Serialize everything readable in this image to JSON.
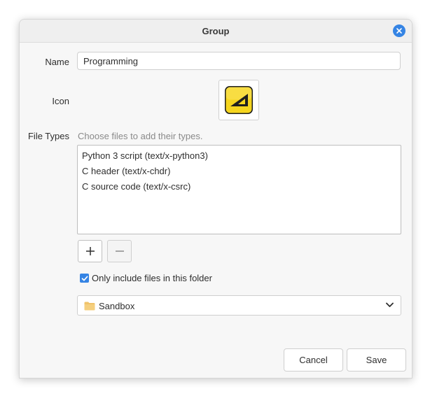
{
  "dialog": {
    "title": "Group"
  },
  "form": {
    "name_label": "Name",
    "name_value": "Programming",
    "icon_label": "Icon",
    "icon_name": "accessories-text-editor-icon",
    "file_types_label": "File Types",
    "file_types_hint": "Choose files to add their types.",
    "file_types": [
      "Python 3 script (text/x-python3)",
      "C header (text/x-chdr)",
      "C source code (text/x-csrc)"
    ],
    "add_icon": "plus-icon",
    "remove_icon": "minus-icon",
    "only_folder_label": "Only include files in this folder",
    "only_folder_checked": true,
    "folder": "Sandbox"
  },
  "actions": {
    "cancel_label": "Cancel",
    "save_label": "Save"
  },
  "colors": {
    "accent": "#3584e4",
    "icon_yellow": "#f5d51e",
    "folder": "#f0c36a"
  }
}
